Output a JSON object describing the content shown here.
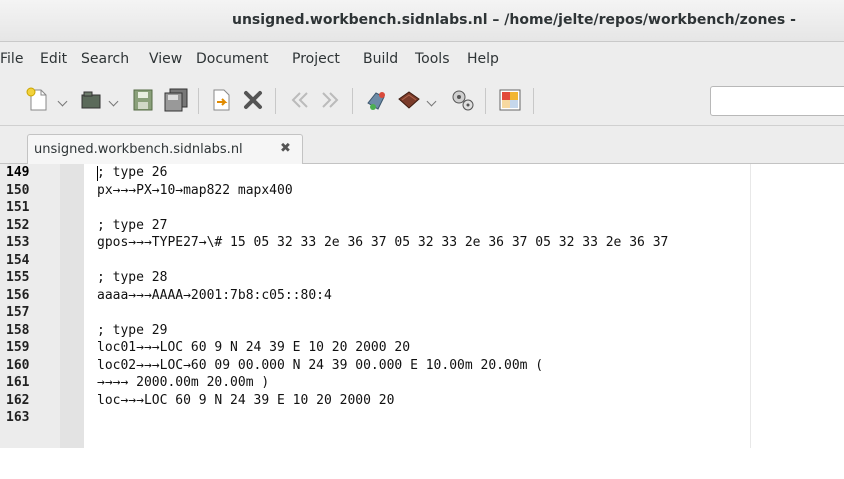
{
  "window": {
    "title": "unsigned.workbench.sidnlabs.nl – /home/jelte/repos/workbench/zones -"
  },
  "menu": [
    "File",
    "Edit",
    "Search",
    "View",
    "Document",
    "Project",
    "Build",
    "Tools",
    "Help"
  ],
  "toolbar": {
    "icons": [
      "new-file-icon",
      "open-file-icon",
      "save-icon",
      "save-all-icon",
      "revert-icon",
      "close-icon",
      "navigate-back-icon",
      "navigate-forward-icon",
      "compile-icon",
      "build-icon",
      "execute-icon",
      "color-chooser-icon"
    ],
    "search_value": ""
  },
  "tab": {
    "label": "unsigned.workbench.sidnlabs.nl",
    "close": "✖"
  },
  "editor": {
    "lines": [
      {
        "num": "149",
        "text": "; type 26"
      },
      {
        "num": "150",
        "text": "px→→→PX→10→map822 mapx400"
      },
      {
        "num": "151",
        "text": ""
      },
      {
        "num": "152",
        "text": "; type 27"
      },
      {
        "num": "153",
        "text": "gpos→→→TYPE27→\\# 15 05 32 33 2e 36 37 05 32 33 2e 36 37 05 32 33 2e 36 37"
      },
      {
        "num": "154",
        "text": ""
      },
      {
        "num": "155",
        "text": "; type 28"
      },
      {
        "num": "156",
        "text": "aaaa→→→AAAA→2001:7b8:c05::80:4"
      },
      {
        "num": "157",
        "text": ""
      },
      {
        "num": "158",
        "text": "; type 29"
      },
      {
        "num": "159",
        "text": "loc01→→→LOC 60 9 N 24 39 E 10 20 2000 20"
      },
      {
        "num": "160",
        "text": "loc02→→→LOC→60 09 00.000 N 24 39 00.000 E 10.00m 20.00m ("
      },
      {
        "num": "161",
        "text": "→→→→ 2000.00m 20.00m )"
      },
      {
        "num": "162",
        "text": "loc→→→LOC 60 9 N 24 39 E 10 20 2000 20"
      },
      {
        "num": "163",
        "text": ""
      }
    ]
  },
  "colors": {
    "chrome": "#ededed",
    "gutter": "#ececec",
    "text": "#111111"
  }
}
